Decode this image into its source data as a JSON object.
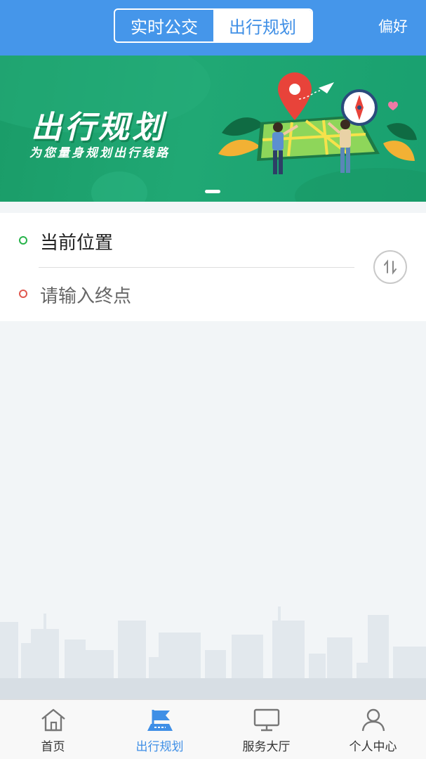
{
  "header": {
    "tabs": [
      {
        "label": "实时公交",
        "active": false
      },
      {
        "label": "出行规划",
        "active": true
      }
    ],
    "preference_label": "偏好"
  },
  "banner": {
    "title": "出行规划",
    "subtitle": "为您量身规划出行线路",
    "page_count": 1,
    "current_page": 1
  },
  "route": {
    "start_value": "当前位置",
    "end_placeholder": "请输入终点",
    "swap_icon": "swap-vertical-icon"
  },
  "bottom_nav": {
    "items": [
      {
        "label": "首页",
        "icon": "home-icon",
        "active": false
      },
      {
        "label": "出行规划",
        "icon": "route-flag-icon",
        "active": true
      },
      {
        "label": "服务大厅",
        "icon": "monitor-icon",
        "active": false
      },
      {
        "label": "个人中心",
        "icon": "person-icon",
        "active": false
      }
    ]
  },
  "colors": {
    "header_bg": "#4596ea",
    "accent": "#3f8fe6",
    "banner_bg": "#1fa472",
    "start_dot": "#27b34a",
    "end_dot": "#e0584f"
  }
}
